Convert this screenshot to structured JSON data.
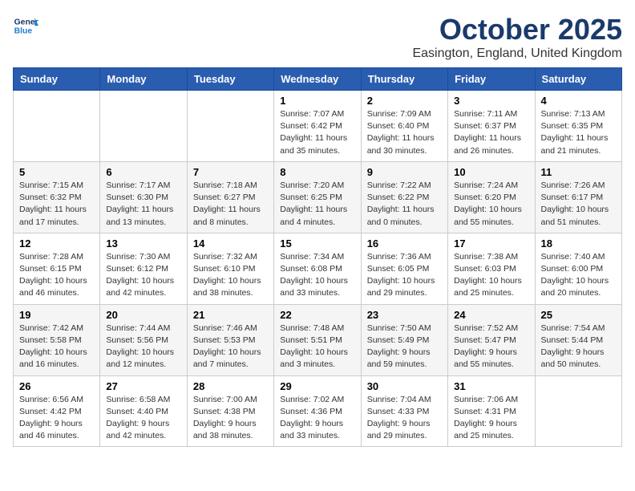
{
  "logo": {
    "line1": "General",
    "line2": "Blue"
  },
  "title": "October 2025",
  "location": "Easington, England, United Kingdom",
  "days_of_week": [
    "Sunday",
    "Monday",
    "Tuesday",
    "Wednesday",
    "Thursday",
    "Friday",
    "Saturday"
  ],
  "weeks": [
    [
      {
        "day": "",
        "info": ""
      },
      {
        "day": "",
        "info": ""
      },
      {
        "day": "",
        "info": ""
      },
      {
        "day": "1",
        "info": "Sunrise: 7:07 AM\nSunset: 6:42 PM\nDaylight: 11 hours\nand 35 minutes."
      },
      {
        "day": "2",
        "info": "Sunrise: 7:09 AM\nSunset: 6:40 PM\nDaylight: 11 hours\nand 30 minutes."
      },
      {
        "day": "3",
        "info": "Sunrise: 7:11 AM\nSunset: 6:37 PM\nDaylight: 11 hours\nand 26 minutes."
      },
      {
        "day": "4",
        "info": "Sunrise: 7:13 AM\nSunset: 6:35 PM\nDaylight: 11 hours\nand 21 minutes."
      }
    ],
    [
      {
        "day": "5",
        "info": "Sunrise: 7:15 AM\nSunset: 6:32 PM\nDaylight: 11 hours\nand 17 minutes."
      },
      {
        "day": "6",
        "info": "Sunrise: 7:17 AM\nSunset: 6:30 PM\nDaylight: 11 hours\nand 13 minutes."
      },
      {
        "day": "7",
        "info": "Sunrise: 7:18 AM\nSunset: 6:27 PM\nDaylight: 11 hours\nand 8 minutes."
      },
      {
        "day": "8",
        "info": "Sunrise: 7:20 AM\nSunset: 6:25 PM\nDaylight: 11 hours\nand 4 minutes."
      },
      {
        "day": "9",
        "info": "Sunrise: 7:22 AM\nSunset: 6:22 PM\nDaylight: 11 hours\nand 0 minutes."
      },
      {
        "day": "10",
        "info": "Sunrise: 7:24 AM\nSunset: 6:20 PM\nDaylight: 10 hours\nand 55 minutes."
      },
      {
        "day": "11",
        "info": "Sunrise: 7:26 AM\nSunset: 6:17 PM\nDaylight: 10 hours\nand 51 minutes."
      }
    ],
    [
      {
        "day": "12",
        "info": "Sunrise: 7:28 AM\nSunset: 6:15 PM\nDaylight: 10 hours\nand 46 minutes."
      },
      {
        "day": "13",
        "info": "Sunrise: 7:30 AM\nSunset: 6:12 PM\nDaylight: 10 hours\nand 42 minutes."
      },
      {
        "day": "14",
        "info": "Sunrise: 7:32 AM\nSunset: 6:10 PM\nDaylight: 10 hours\nand 38 minutes."
      },
      {
        "day": "15",
        "info": "Sunrise: 7:34 AM\nSunset: 6:08 PM\nDaylight: 10 hours\nand 33 minutes."
      },
      {
        "day": "16",
        "info": "Sunrise: 7:36 AM\nSunset: 6:05 PM\nDaylight: 10 hours\nand 29 minutes."
      },
      {
        "day": "17",
        "info": "Sunrise: 7:38 AM\nSunset: 6:03 PM\nDaylight: 10 hours\nand 25 minutes."
      },
      {
        "day": "18",
        "info": "Sunrise: 7:40 AM\nSunset: 6:00 PM\nDaylight: 10 hours\nand 20 minutes."
      }
    ],
    [
      {
        "day": "19",
        "info": "Sunrise: 7:42 AM\nSunset: 5:58 PM\nDaylight: 10 hours\nand 16 minutes."
      },
      {
        "day": "20",
        "info": "Sunrise: 7:44 AM\nSunset: 5:56 PM\nDaylight: 10 hours\nand 12 minutes."
      },
      {
        "day": "21",
        "info": "Sunrise: 7:46 AM\nSunset: 5:53 PM\nDaylight: 10 hours\nand 7 minutes."
      },
      {
        "day": "22",
        "info": "Sunrise: 7:48 AM\nSunset: 5:51 PM\nDaylight: 10 hours\nand 3 minutes."
      },
      {
        "day": "23",
        "info": "Sunrise: 7:50 AM\nSunset: 5:49 PM\nDaylight: 9 hours\nand 59 minutes."
      },
      {
        "day": "24",
        "info": "Sunrise: 7:52 AM\nSunset: 5:47 PM\nDaylight: 9 hours\nand 55 minutes."
      },
      {
        "day": "25",
        "info": "Sunrise: 7:54 AM\nSunset: 5:44 PM\nDaylight: 9 hours\nand 50 minutes."
      }
    ],
    [
      {
        "day": "26",
        "info": "Sunrise: 6:56 AM\nSunset: 4:42 PM\nDaylight: 9 hours\nand 46 minutes."
      },
      {
        "day": "27",
        "info": "Sunrise: 6:58 AM\nSunset: 4:40 PM\nDaylight: 9 hours\nand 42 minutes."
      },
      {
        "day": "28",
        "info": "Sunrise: 7:00 AM\nSunset: 4:38 PM\nDaylight: 9 hours\nand 38 minutes."
      },
      {
        "day": "29",
        "info": "Sunrise: 7:02 AM\nSunset: 4:36 PM\nDaylight: 9 hours\nand 33 minutes."
      },
      {
        "day": "30",
        "info": "Sunrise: 7:04 AM\nSunset: 4:33 PM\nDaylight: 9 hours\nand 29 minutes."
      },
      {
        "day": "31",
        "info": "Sunrise: 7:06 AM\nSunset: 4:31 PM\nDaylight: 9 hours\nand 25 minutes."
      },
      {
        "day": "",
        "info": ""
      }
    ]
  ]
}
